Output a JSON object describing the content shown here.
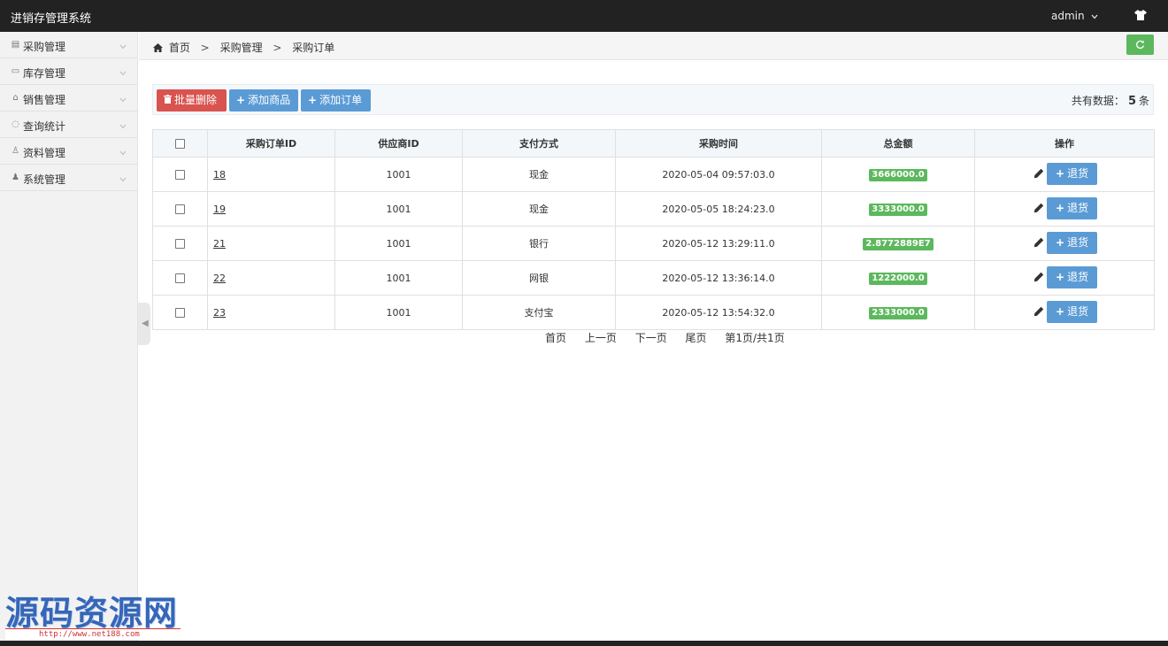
{
  "app": {
    "title": "进销存管理系统",
    "user": "admin"
  },
  "sidebar": {
    "items": [
      {
        "label": "采购管理",
        "icon": "list-icon"
      },
      {
        "label": "库存管理",
        "icon": "card-icon"
      },
      {
        "label": "销售管理",
        "icon": "bag-icon"
      },
      {
        "label": "查询统计",
        "icon": "chat-icon"
      },
      {
        "label": "资料管理",
        "icon": "user-outline-icon"
      },
      {
        "label": "系统管理",
        "icon": "user-solid-icon"
      }
    ]
  },
  "breadcrumb": {
    "home": "首页",
    "section": "采购管理",
    "page": "采购订单",
    "separator": ">"
  },
  "toolbar": {
    "batch_delete": "批量删除",
    "add_goods": "添加商品",
    "add_order": "添加订单",
    "total_prefix": "共有数据：",
    "total_count": "5",
    "total_suffix": "条"
  },
  "table": {
    "headers": [
      "采购订单ID",
      "供应商ID",
      "支付方式",
      "采购时间",
      "总金额",
      "操作"
    ],
    "rows": [
      {
        "id": "18",
        "supplier": "1001",
        "payment": "现金",
        "time": "2020-05-04 09:57:03.0",
        "amount": "3666000.0"
      },
      {
        "id": "19",
        "supplier": "1001",
        "payment": "现金",
        "time": "2020-05-05 18:24:23.0",
        "amount": "3333000.0"
      },
      {
        "id": "21",
        "supplier": "1001",
        "payment": "银行",
        "time": "2020-05-12 13:29:11.0",
        "amount": "2.8772889E7"
      },
      {
        "id": "22",
        "supplier": "1001",
        "payment": "网银",
        "time": "2020-05-12 13:36:14.0",
        "amount": "1222000.0"
      },
      {
        "id": "23",
        "supplier": "1001",
        "payment": "支付宝",
        "time": "2020-05-12 13:54:32.0",
        "amount": "2333000.0"
      }
    ],
    "return_label": "退货"
  },
  "pager": {
    "first": "首页",
    "prev": "上一页",
    "next": "下一页",
    "last": "尾页",
    "info": "第1页/共1页"
  },
  "watermark": {
    "title": "源码资源网",
    "url": "http://www.net188.com"
  },
  "colors": {
    "topbar": "#222222",
    "danger": "#d9534f",
    "primary": "#5b9bd5",
    "success": "#5cb85c",
    "sidebar": "#f2f2f2"
  }
}
